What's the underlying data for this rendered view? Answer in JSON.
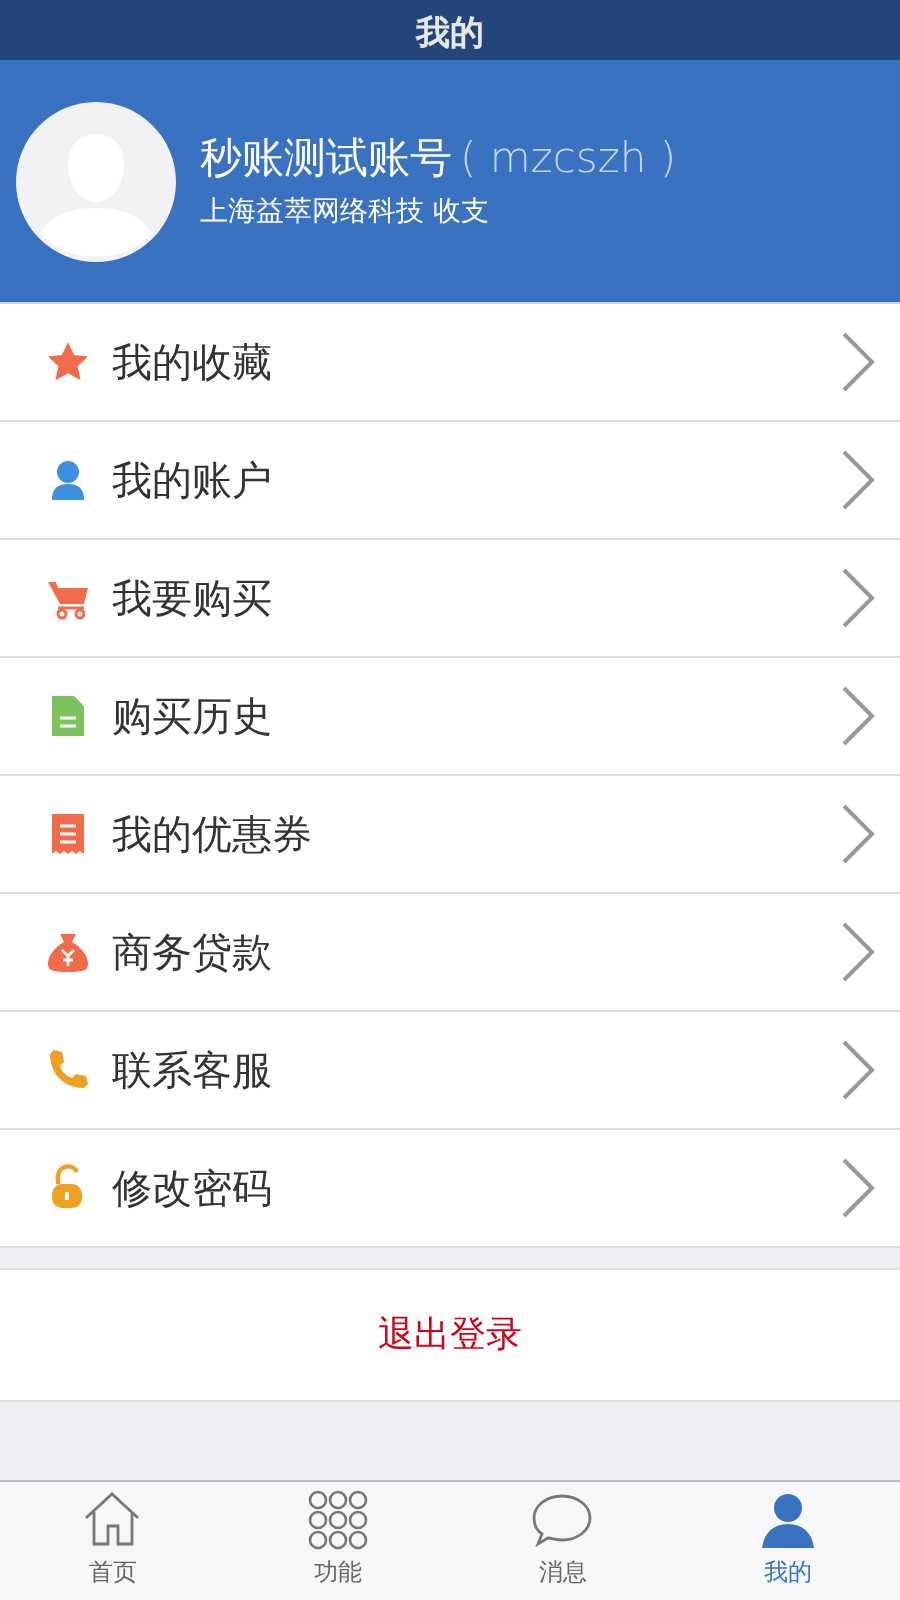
{
  "title": "我的",
  "profile": {
    "name": "秒账测试账号",
    "account": "( mzcszh )",
    "company": "上海益萃网络科技 收支"
  },
  "menu": [
    {
      "kind": "star",
      "label": "我的收藏"
    },
    {
      "kind": "user",
      "label": "我的账户"
    },
    {
      "kind": "cart",
      "label": "我要购买"
    },
    {
      "kind": "doc",
      "label": "购买历史"
    },
    {
      "kind": "coupon",
      "label": "我的优惠券"
    },
    {
      "kind": "moneybag",
      "label": "商务贷款"
    },
    {
      "kind": "phone",
      "label": "联系客服"
    },
    {
      "kind": "lock",
      "label": "修改密码"
    }
  ],
  "logout": "退出登录",
  "tabs": [
    {
      "kind": "home",
      "label": "首页",
      "selected": false
    },
    {
      "kind": "grid",
      "label": "功能",
      "selected": false
    },
    {
      "kind": "chat",
      "label": "消息",
      "selected": false
    },
    {
      "kind": "user",
      "label": "我的",
      "selected": true
    }
  ]
}
